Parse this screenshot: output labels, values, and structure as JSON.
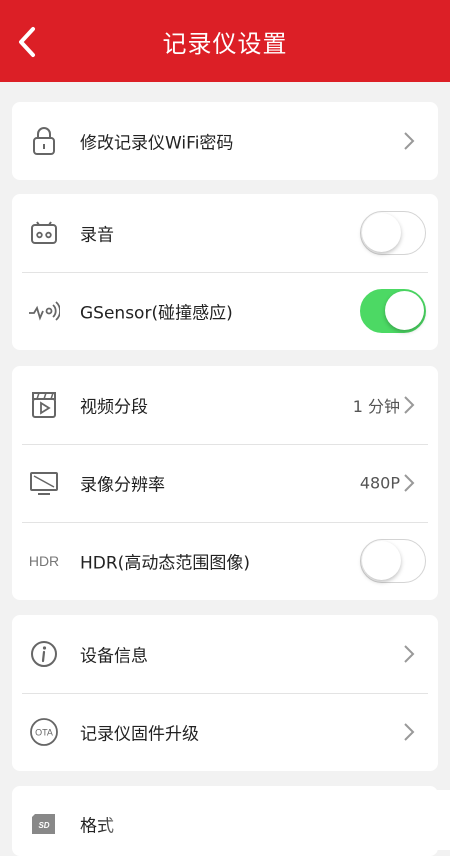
{
  "header": {
    "title": "记录仪设置",
    "back_icon": "chevron-left-icon"
  },
  "groups": [
    {
      "items": [
        {
          "label": "修改记录仪WiFi密码",
          "icon": "lock-icon",
          "control": "chevron"
        }
      ]
    },
    {
      "items": [
        {
          "label": "录音",
          "icon": "microphone-box-icon",
          "control": "toggle",
          "on": false
        },
        {
          "label": "GSensor(碰撞感应)",
          "icon": "gsensor-icon",
          "control": "toggle",
          "on": true
        }
      ]
    },
    {
      "items": [
        {
          "label": "视频分段",
          "icon": "video-clip-icon",
          "value": "1 分钟",
          "control": "chevron"
        },
        {
          "label": "录像分辨率",
          "icon": "monitor-icon",
          "value": "480P",
          "control": "chevron"
        },
        {
          "label": "HDR(高动态范围图像)",
          "icon": "hdr-icon",
          "icon_text": "HDR",
          "control": "toggle",
          "on": false
        }
      ]
    },
    {
      "items": [
        {
          "label": "设备信息",
          "icon": "info-icon",
          "control": "chevron"
        },
        {
          "label": "记录仪固件升级",
          "icon": "ota-icon",
          "icon_text": "OTA",
          "control": "chevron"
        }
      ]
    },
    {
      "items": [
        {
          "label": "格式",
          "icon": "sd-card-icon",
          "icon_text": "SD",
          "control": "none"
        }
      ]
    }
  ],
  "colors": {
    "header_bg": "#dc1f26",
    "toggle_on": "#4cd964",
    "page_bg": "#f2f2f2"
  }
}
